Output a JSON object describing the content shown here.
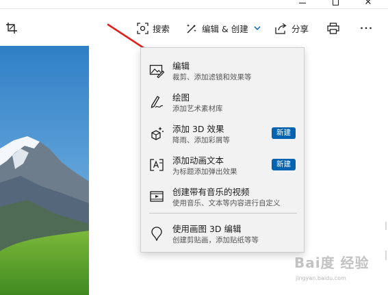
{
  "toolbar": {
    "search_label": "搜索",
    "edit_create_label": "编辑 & 创建",
    "share_label": "分享"
  },
  "menu": {
    "items": [
      {
        "title": "编辑",
        "subtitle": "裁剪、添加滤镜和效果等",
        "icon": "image-edit-icon",
        "badge": null
      },
      {
        "title": "绘图",
        "subtitle": "添加艺术素材库",
        "icon": "pen-draw-icon",
        "badge": null
      },
      {
        "title": "添加 3D 效果",
        "subtitle": "降雨、添加彩屑等",
        "icon": "3d-effects-icon",
        "badge": "新建"
      },
      {
        "title": "添加动画文本",
        "subtitle": "为标题添加弹出效果",
        "icon": "animated-text-icon",
        "badge": "新建"
      },
      {
        "title": "创建带有音乐的视频",
        "subtitle": "使用音乐、文本等内容进行自定义",
        "icon": "video-music-icon",
        "badge": null
      },
      {
        "title": "使用画图 3D 编辑",
        "subtitle": "创建剪贴画，添加贴纸等等",
        "icon": "paint3d-icon",
        "badge": null
      }
    ]
  },
  "watermark": {
    "text": "Bai度 经验",
    "url": "jingyan.baidu.com"
  },
  "colors": {
    "badge": "#0063b1",
    "arrow": "#e0201b",
    "menu_bg": "#f2f2f2"
  }
}
